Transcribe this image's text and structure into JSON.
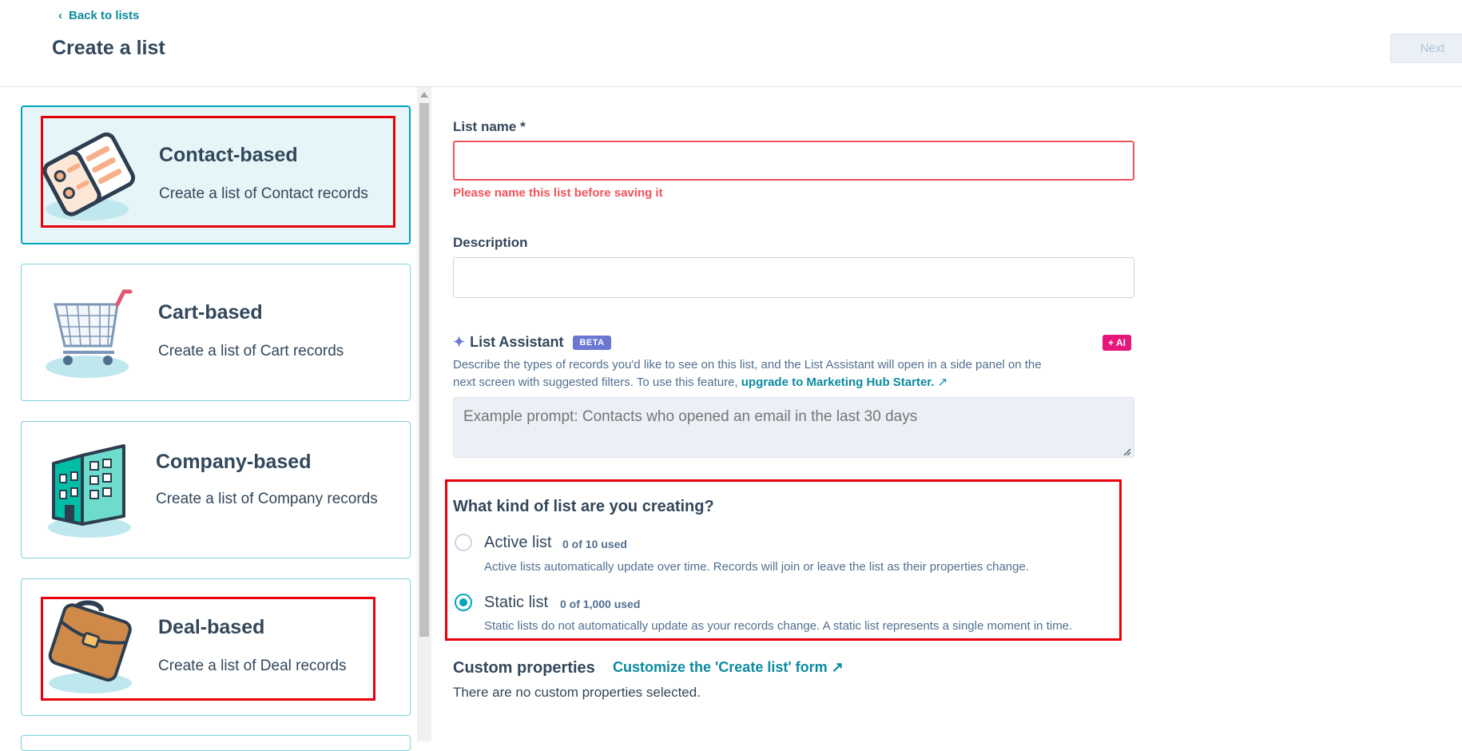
{
  "header": {
    "back_label": "Back to lists",
    "title": "Create a list",
    "next_label": "Next"
  },
  "cards": [
    {
      "title": "Contact-based",
      "desc": "Create a list of Contact records",
      "selected": true
    },
    {
      "title": "Cart-based",
      "desc": "Create a list of Cart records",
      "selected": false
    },
    {
      "title": "Company-based",
      "desc": "Create a list of Company records",
      "selected": false
    },
    {
      "title": "Deal-based",
      "desc": "Create a list of Deal records",
      "selected": false
    }
  ],
  "form": {
    "list_name_label": "List name *",
    "list_name_value": "",
    "list_name_error": "Please name this list before saving it",
    "description_label": "Description",
    "description_value": "",
    "assistant": {
      "title": "List Assistant",
      "beta": "BETA",
      "ai_badge": "+ AI",
      "desc_text": "Describe the types of records you'd like to see on this list, and the List Assistant will open in a side panel on the next screen with suggested filters. To use this feature,",
      "desc_link": "upgrade to Marketing Hub Starter.",
      "prompt_placeholder": "Example prompt: Contacts who opened an email in the last 30 days"
    },
    "kind": {
      "title": "What kind of list are you creating?",
      "options": [
        {
          "label": "Active list",
          "count": "0 of 10 used",
          "desc": "Active lists automatically update over time. Records will join or leave the list as their properties change.",
          "checked": false
        },
        {
          "label": "Static list",
          "count": "0 of 1,000 used",
          "desc": "Static lists do not automatically update as your records change. A static list represents a single moment in time.",
          "checked": true
        }
      ]
    },
    "custom": {
      "title": "Custom properties",
      "link": "Customize the 'Create list' form",
      "empty": "There are no custom properties selected."
    }
  },
  "colors": {
    "accent": "#00a4bd",
    "link": "#0b8aa0",
    "error": "#f2545b",
    "annotation_red": "#e8000b"
  }
}
